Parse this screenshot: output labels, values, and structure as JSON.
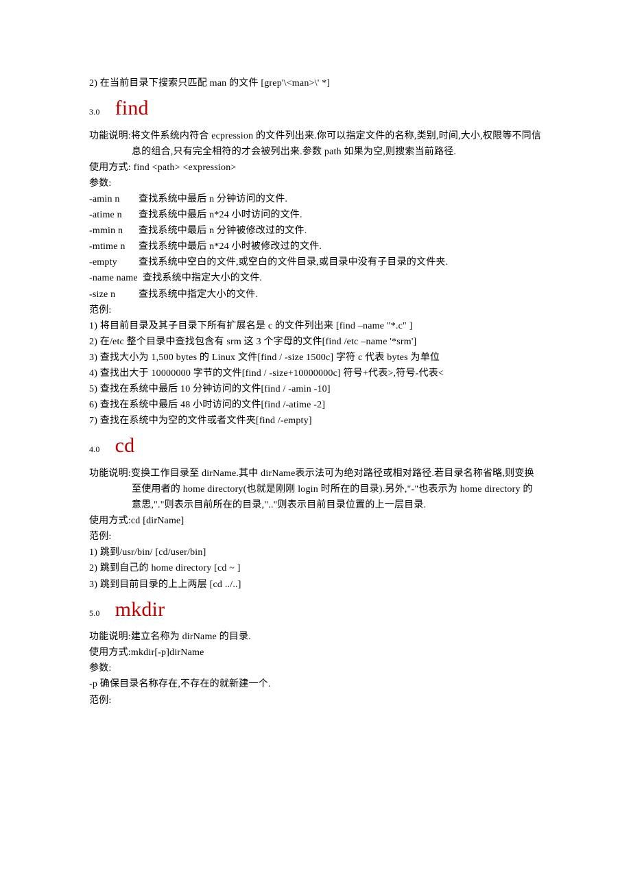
{
  "intro_numbered": "2) 在当前目录下搜索只匹配 man 的文件 [grep'\\<man>\\' *]",
  "sections": [
    {
      "num": "3.0",
      "title": "find",
      "desc": "功能说明:将文件系统内符合 ecpression 的文件列出来.你可以指定文件的名称,类别,时间,大小,权限等不同信息的组合,只有完全相符的才会被列出来.参数 path 如果为空,则搜索当前路径.",
      "usage": "使用方式: find <path> <expression>",
      "param_heading": "参数:",
      "params": [
        {
          "n": "-amin n",
          "d": "查找系统中最后 n 分钟访问的文件."
        },
        {
          "n": "-atime n",
          "d": "查找系统中最后 n*24 小时访问的文件."
        },
        {
          "n": "-mmin n",
          "d": "查找系统中最后 n 分钟被修改过的文件."
        },
        {
          "n": "-mtime n",
          "d": "查找系统中最后 n*24 小时被修改过的文件."
        },
        {
          "n": "-empty",
          "d": "查找系统中空白的文件,或空白的文件目录,或目录中没有子目录的文件夹."
        },
        {
          "n": "-name name",
          "d": "查找系统中指定大小的文件."
        },
        {
          "n": "-size n",
          "d": "查找系统中指定大小的文件."
        }
      ],
      "ex_heading": "范例:",
      "examples": [
        "1) 将目前目录及其子目录下所有扩展名是 c 的文件列出来 [find –name \"*.c\" ]",
        "2) 在/etc 整个目录中查找包含有 srm 这 3 个字母的文件[find /etc –name '*srm']",
        "3) 查找大小为 1,500 bytes 的 Linux 文件[find / -size 1500c] 字符 c 代表 bytes 为单位",
        "4) 查找出大于 10000000 字节的文件[find / -size+10000000c] 符号+代表>,符号-代表<",
        "5) 查找在系统中最后 10 分钟访问的文件[find / -amin -10]",
        "6) 查找在系统中最后 48 小时访问的文件[find /-atime -2]",
        "7) 查找在系统中为空的文件或者文件夹[find /-empty]"
      ]
    },
    {
      "num": "4.0",
      "title": "cd",
      "desc": "功能说明:变换工作目录至 dirName.其中 dirName表示法可为绝对路径或相对路径.若目录名称省略,则变换至使用者的 home directory(也就是刚刚 login 时所在的目录).另外,\"-\"也表示为 home directory 的意思,\".\"则表示目前所在的目录,\"..\"则表示目前目录位置的上一层目录.",
      "usage": "使用方式:cd [dirName]",
      "ex_heading": "范例:",
      "examples": [
        "1) 跳到/usr/bin/ [cd/user/bin]",
        "2) 跳到自己的 home directory [cd ~ ]",
        "3) 跳到目前目录的上上两层 [cd ../..]"
      ]
    },
    {
      "num": "5.0",
      "title": "mkdir",
      "desc_plain": "功能说明:建立名称为 dirName 的目录.",
      "usage": "使用方式:mkdir[-p]dirName",
      "param_heading": "参数:",
      "param_plain": "-p 确保目录名称存在,不存在的就新建一个.",
      "ex_heading": "范例:"
    }
  ]
}
